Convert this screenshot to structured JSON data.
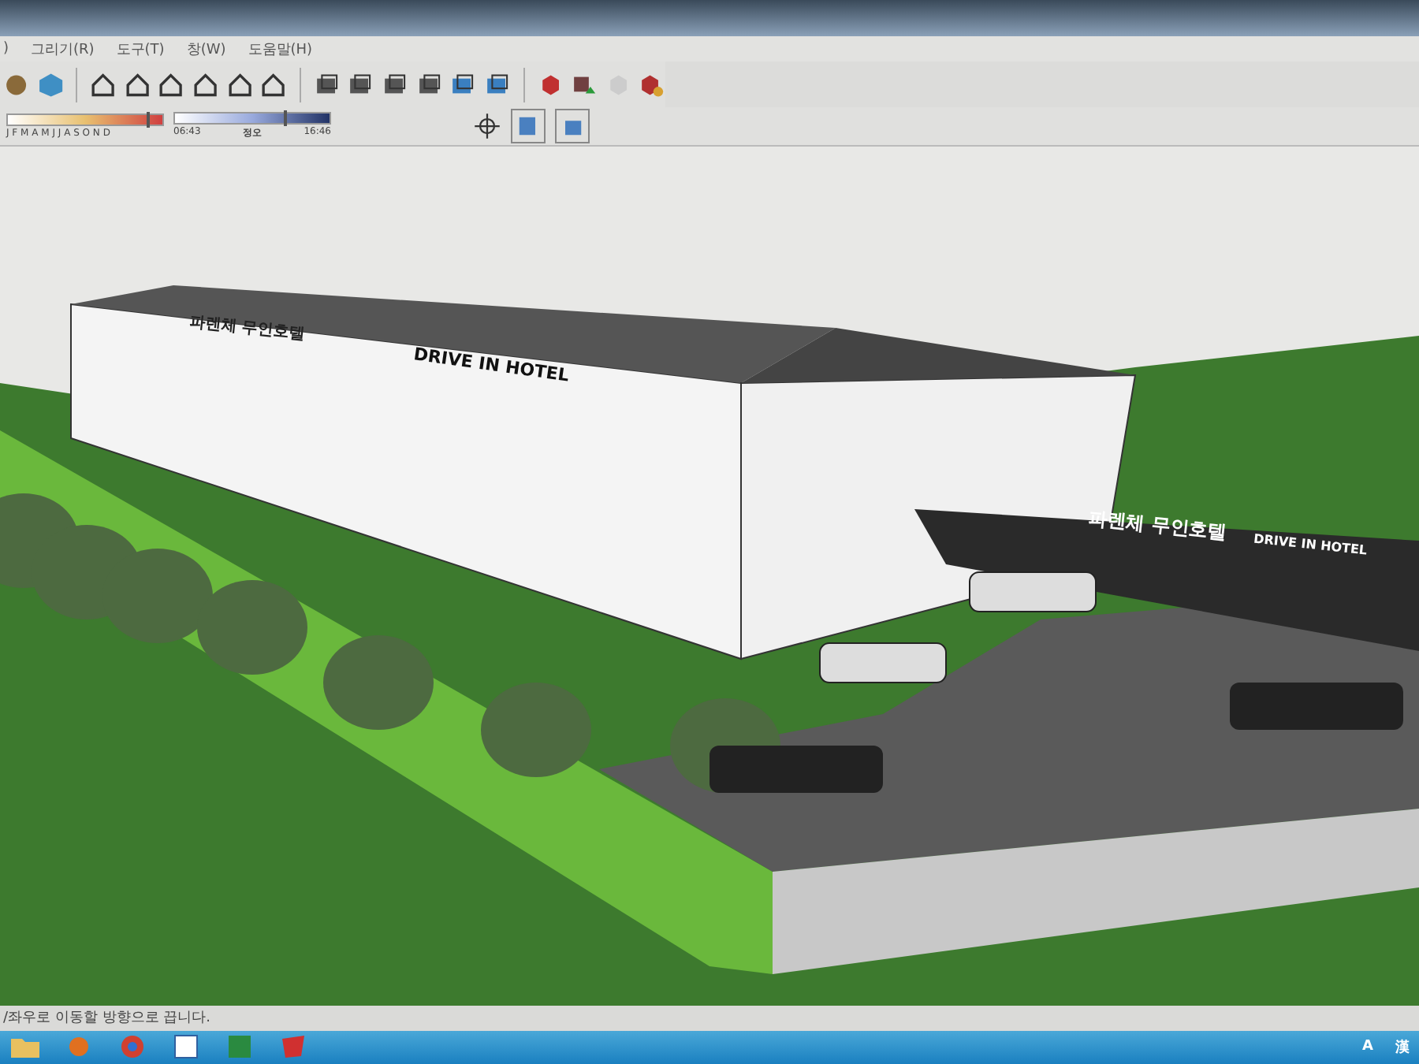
{
  "menu": [
    ")",
    "그리기(R)",
    "도구(T)",
    "창(W)",
    "도움말(H)"
  ],
  "shadow_settings": {
    "months": "J F M A M J J A S O N D",
    "date_slider": {
      "level": 0.9
    },
    "time_start": "06:43",
    "time_mid": "정오",
    "time_end": "16:46",
    "time_slider": {
      "level": 0.7
    }
  },
  "model_signs": {
    "roof_sign": "DRIVE IN HOTEL",
    "side_sign": "파렌체 무인호텔",
    "gate_sign_korean": "파렌체 무인호텔",
    "gate_sign_english": "DRIVE IN HOTEL"
  },
  "status_bar": {
    "hint": "/좌우로 이동할 방향으로 끕니다."
  },
  "taskbar": {
    "tray": [
      "A",
      "漢"
    ]
  }
}
